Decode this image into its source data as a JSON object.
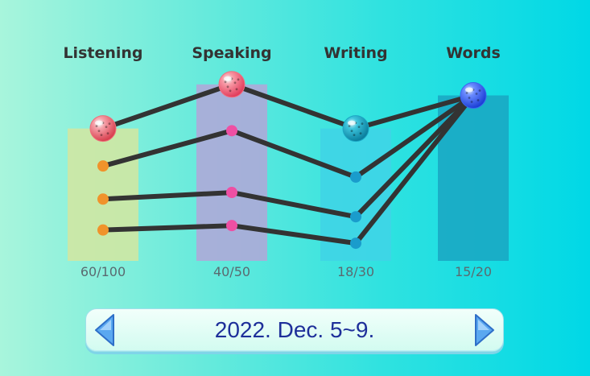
{
  "chart_data": {
    "type": "bar",
    "categories": [
      "Listening",
      "Speaking",
      "Writing",
      "Words"
    ],
    "bars": [
      {
        "category": "Listening",
        "score": 60,
        "max": 100,
        "label": "60/100",
        "color": "#d4e6a0"
      },
      {
        "category": "Speaking",
        "score": 40,
        "max": 50,
        "label": "40/50",
        "color": "#b3a6d8"
      },
      {
        "category": "Writing",
        "score": 18,
        "max": 30,
        "label": "18/30",
        "color": "#3fd3e6"
      },
      {
        "category": "Words",
        "score": 15,
        "max": 20,
        "label": "15/20",
        "color": "#1aa6c2"
      }
    ],
    "ylim": [
      0,
      1
    ],
    "lines": [
      {
        "values": [
          0.6,
          0.8,
          0.6,
          0.75
        ],
        "marker": "ball"
      },
      {
        "values": [
          0.43,
          0.59,
          0.38,
          0.75
        ],
        "marker": "dot"
      },
      {
        "values": [
          0.28,
          0.31,
          0.2,
          0.75
        ],
        "marker": "dot"
      },
      {
        "values": [
          0.14,
          0.16,
          0.08,
          0.75
        ],
        "marker": "dot"
      }
    ],
    "marker_colors": [
      "#f0932b",
      "#ee4fa3",
      "#1a9ccc",
      "#116d9a"
    ],
    "ball_colors": [
      "#ee6f7a",
      "#f06f80",
      "#1ba6c4",
      "#3a66f0"
    ],
    "grid": false,
    "legend": "none"
  },
  "navigator": {
    "date_range": "2022. Dec. 5~9.",
    "prev_icon": "left-arrow-icon",
    "next_icon": "right-arrow-icon"
  }
}
